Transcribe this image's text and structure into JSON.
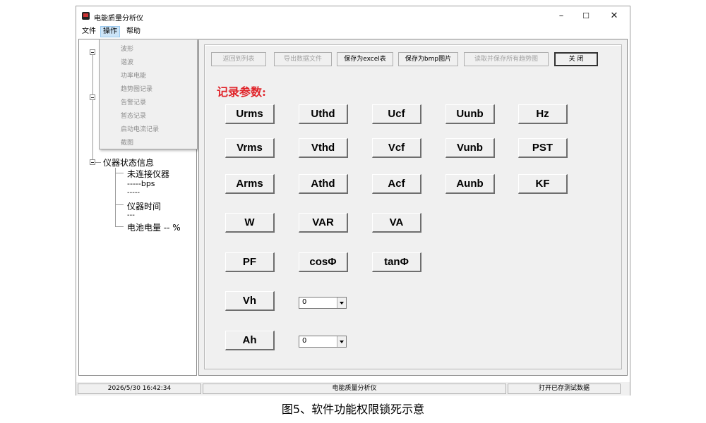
{
  "window": {
    "title": "电能质量分析仪",
    "controls": {
      "minimize": "–",
      "maximize": "☐",
      "close": "✕"
    }
  },
  "menubar": {
    "items": [
      "文件",
      "操作",
      "帮助"
    ],
    "active": "操作"
  },
  "dropdown": {
    "items": [
      "波形",
      "谐波",
      "功率电能",
      "趋势图记录",
      "告警记录",
      "暂态记录",
      "启动电流记录",
      "截图"
    ],
    "state": "disabled",
    "text_color": "#8d8d8d"
  },
  "tree": {
    "root": "仪器状态信息",
    "children": [
      "未连接仪器",
      "-----bps",
      "-----",
      "仪器时间",
      "---",
      "电池电量 -- %"
    ]
  },
  "toolbar": {
    "back": "返回到列表",
    "export": "导出数据文件",
    "save_excel": "保存为excel表",
    "save_bmp": "保存为bmp图片",
    "read_trend": "读取并保存所有趋势图",
    "close": "关 闭"
  },
  "record": {
    "label": "记录参数:",
    "label_color": "#e0242a",
    "rows": [
      [
        "Urms",
        "Uthd",
        "Ucf",
        "Uunb",
        "Hz"
      ],
      [
        "Vrms",
        "Vthd",
        "Vcf",
        "Vunb",
        "PST"
      ],
      [
        "Arms",
        "Athd",
        "Acf",
        "Aunb",
        "KF"
      ],
      [
        "W",
        "VAR",
        "VA"
      ],
      [
        "PF",
        "cosΦ",
        "tanΦ"
      ]
    ],
    "vh_label": "Vh",
    "vh_value": "0",
    "ah_label": "Ah",
    "ah_value": "0"
  },
  "status": {
    "datetime": "2026/5/30 16:42:34",
    "app": "电能质量分析仪",
    "action": "打开已存测试数据"
  },
  "caption": "图5、软件功能权限锁死示意"
}
